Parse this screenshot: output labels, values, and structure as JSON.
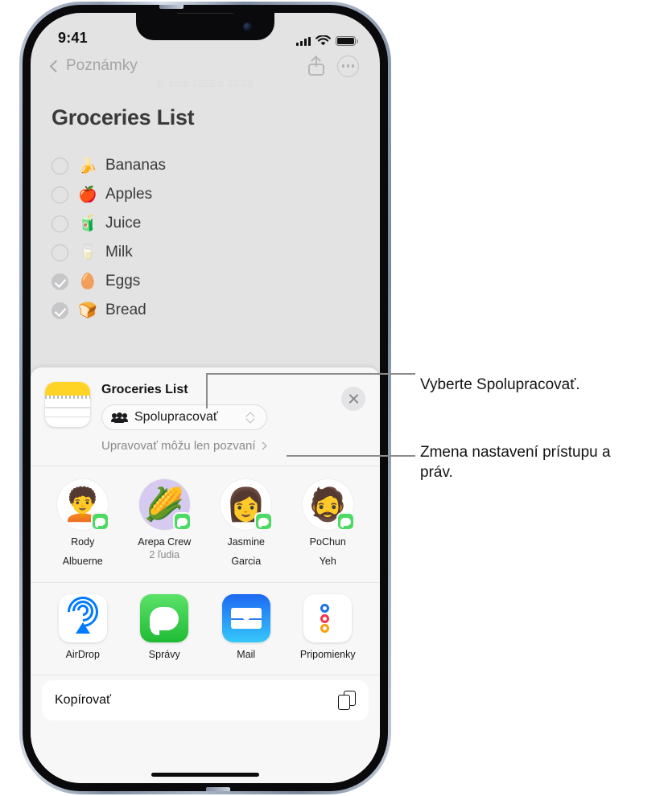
{
  "status_bar": {
    "time": "9:41",
    "signal_icon": "cellular-bars-icon",
    "wifi_icon": "wifi-icon",
    "battery_icon": "battery-full-icon"
  },
  "note": {
    "back_label": "Poznámky",
    "date": "8. júna 2022 o 20:39",
    "title": "Groceries List",
    "share_icon": "share-icon",
    "more_icon": "more-options-icon",
    "items": [
      {
        "emoji": "🍌",
        "label": "Bananas",
        "checked": false
      },
      {
        "emoji": "🍎",
        "label": "Apples",
        "checked": false
      },
      {
        "emoji": "🧃",
        "label": "Juice",
        "checked": false
      },
      {
        "emoji": "🥛",
        "label": "Milk",
        "checked": false
      },
      {
        "emoji": "🥚",
        "label": "Eggs",
        "checked": true
      },
      {
        "emoji": "🍞",
        "label": "Bread",
        "checked": true
      }
    ]
  },
  "share_sheet": {
    "app_icon": "notes-app-icon",
    "title": "Groceries List",
    "collaborate_label": "Spolupracovať",
    "collaborate_icon": "people-icon",
    "selector_icon": "up-down-chevron-icon",
    "permission_label": "Upravovať môžu len pozvaní",
    "permission_chevron": "chevron-right-icon",
    "close_icon": "close-icon",
    "contacts": [
      {
        "name_line1": "Rody",
        "name_line2": "Albuerne",
        "sub": "",
        "emoji": "🧑‍🦱",
        "bg": "white",
        "badge": "messages-badge-icon"
      },
      {
        "name_line1": "Arepa Crew",
        "name_line2": "",
        "sub": "2 ľudia",
        "emoji": "🌽",
        "bg": "purple",
        "badge": "messages-badge-icon"
      },
      {
        "name_line1": "Jasmine",
        "name_line2": "Garcia",
        "sub": "",
        "emoji": "👩",
        "bg": "white",
        "badge": "messages-badge-icon"
      },
      {
        "name_line1": "PoChun",
        "name_line2": "Yeh",
        "sub": "",
        "emoji": "🧔",
        "bg": "white",
        "badge": "messages-badge-icon"
      }
    ],
    "apps": [
      {
        "name": "AirDrop",
        "icon": "airdrop-icon"
      },
      {
        "name": "Správy",
        "icon": "messages-icon"
      },
      {
        "name": "Mail",
        "icon": "mail-icon"
      },
      {
        "name": "Pripomienky",
        "icon": "reminders-icon"
      }
    ],
    "actions": [
      {
        "label": "Kopírovať",
        "icon": "copy-icon"
      }
    ]
  },
  "callouts": [
    {
      "text": "Vyberte Spolupracovať."
    },
    {
      "text": "Zmena nastavení prístupu a práv."
    }
  ],
  "colors": {
    "accent_blue": "#007aff",
    "messages_green": "#4cd964",
    "notes_yellow": "#ffd426",
    "sheet_bg": "#f7f7f7",
    "screen_bg": "#e3e3e3"
  }
}
